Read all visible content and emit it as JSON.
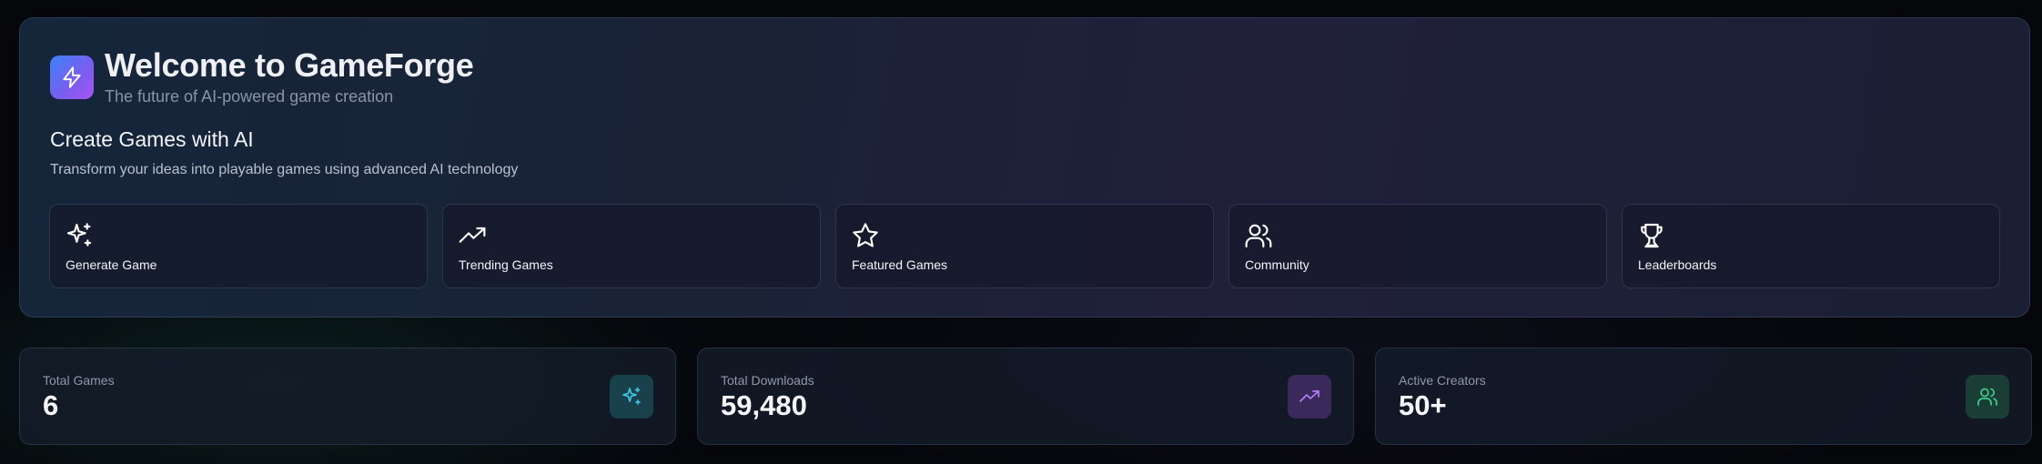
{
  "header": {
    "title": "Welcome to GameForge",
    "subtitle": "The future of AI-powered game creation",
    "brand_icon": "lightning-icon"
  },
  "intro": {
    "title": "Create Games with AI",
    "description": "Transform your ideas into playable games using advanced AI technology"
  },
  "actions": [
    {
      "label": "Generate Game",
      "icon": "sparkles-icon"
    },
    {
      "label": "Trending Games",
      "icon": "trending-up-icon"
    },
    {
      "label": "Featured Games",
      "icon": "star-icon"
    },
    {
      "label": "Community",
      "icon": "users-icon"
    },
    {
      "label": "Leaderboards",
      "icon": "trophy-icon"
    }
  ],
  "stats": [
    {
      "label": "Total Games",
      "value": "6",
      "icon": "sparkles-icon",
      "accent": "#3ec3e0"
    },
    {
      "label": "Total Downloads",
      "value": "59,480",
      "icon": "trending-up-icon",
      "accent": "#b07cf5"
    },
    {
      "label": "Active Creators",
      "value": "50+",
      "icon": "users-icon",
      "accent": "#3fcf8e"
    }
  ],
  "colors": {
    "brand_gradient_start": "#3b82f6",
    "brand_gradient_end": "#a855f7",
    "background": "#05070b"
  }
}
